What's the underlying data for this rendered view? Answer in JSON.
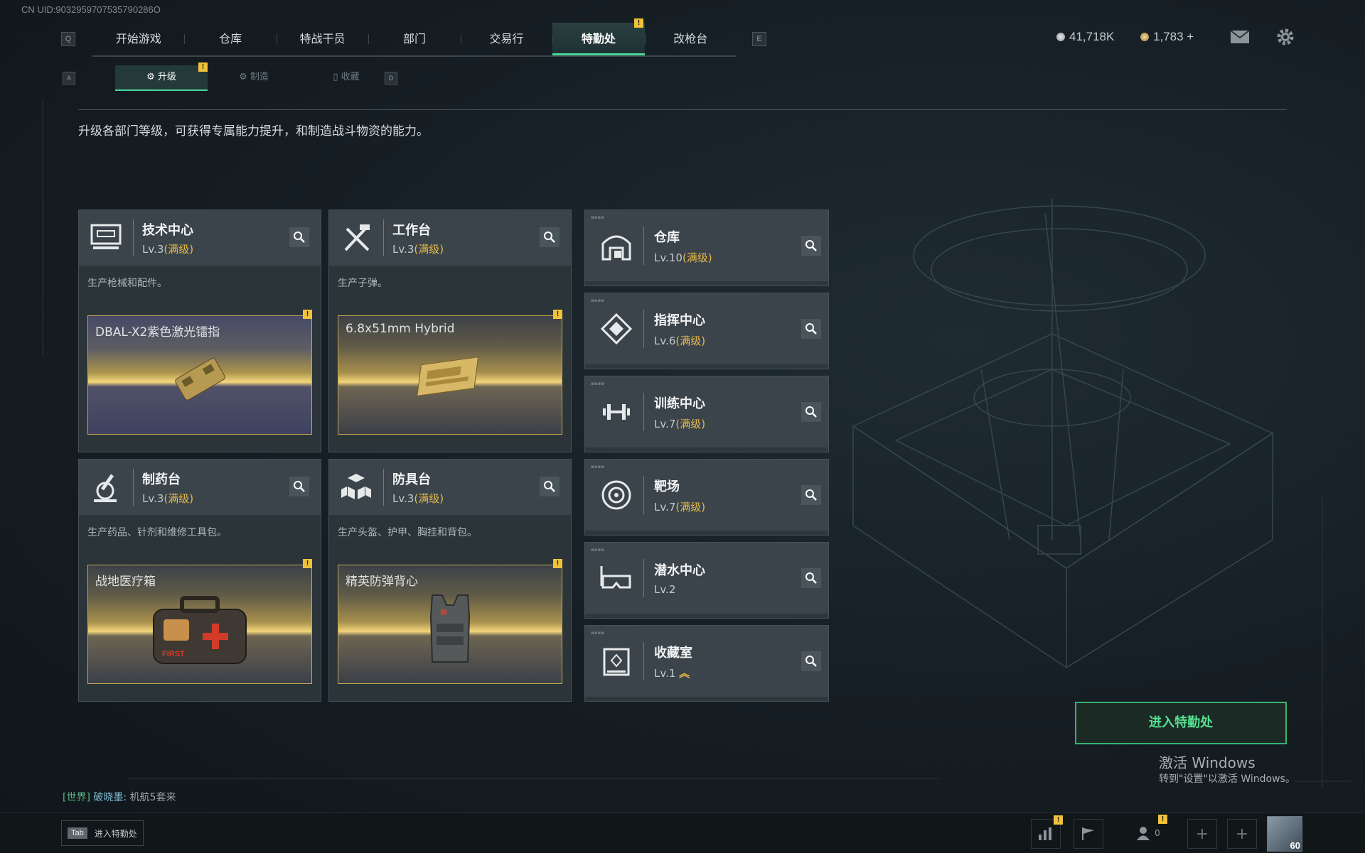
{
  "uid": "CN UID:9032959707535790286O",
  "keys": {
    "left": "Q",
    "right": "E",
    "sub_left": "A",
    "sub_right": "D"
  },
  "topnav": {
    "tabs": [
      "开始游戏",
      "仓库",
      "特战干员",
      "部门",
      "交易行",
      "特勤处",
      "改枪台"
    ],
    "active": "特勤处"
  },
  "currency": {
    "silver": "41,718K",
    "gold": "1,783 +"
  },
  "subnav": {
    "tabs": [
      "升级",
      "制造",
      "收藏"
    ],
    "active": "升级"
  },
  "intro": "升级各部门等级，可获得专属能力提升，和制造战斗物资的能力。",
  "cards": [
    {
      "title": "技术中心",
      "level": "Lv.3",
      "max": "(满级)",
      "desc": "生产枪械和配件。",
      "product": "DBAL-X2紫色激光镭指"
    },
    {
      "title": "工作台",
      "level": "Lv.3",
      "max": "(满级)",
      "desc": "生产子弹。",
      "product": "6.8x51mm Hybrid"
    },
    {
      "title": "制药台",
      "level": "Lv.3",
      "max": "(满级)",
      "desc": "生产药品、针剂和维修工具包。",
      "product": "战地医疗箱",
      "product_label": "FIRST"
    },
    {
      "title": "防具台",
      "level": "Lv.3",
      "max": "(满级)",
      "desc": "生产头盔、护甲、胸挂和背包。",
      "product": "精英防弹背心"
    }
  ],
  "list": [
    {
      "title": "仓库",
      "level": "Lv.10",
      "max": "(满级)"
    },
    {
      "title": "指挥中心",
      "level": "Lv.6",
      "max": "(满级)"
    },
    {
      "title": "训练中心",
      "level": "Lv.7",
      "max": "(满级)"
    },
    {
      "title": "靶场",
      "level": "Lv.7",
      "max": "(满级)"
    },
    {
      "title": "潜水中心",
      "level": "Lv.2",
      "max": ""
    },
    {
      "title": "收藏室",
      "level": "Lv.1",
      "max": ""
    }
  ],
  "enter_button": "进入特勤处",
  "watermark": {
    "line1": "激活 Windows",
    "line2": "转到\"设置\"以激活 Windows。"
  },
  "chat": {
    "channel": "[世界]",
    "name": "破晓墨:",
    "message": "机航5套来"
  },
  "bottombar": {
    "tab_key": "Tab",
    "tab_label": "进入特勤处",
    "friends": "0",
    "level": "60"
  },
  "warn_mark": "!",
  "colors": {
    "accent": "#4bd69a",
    "gold": "#e7b84a",
    "warning": "#f0c23a"
  }
}
